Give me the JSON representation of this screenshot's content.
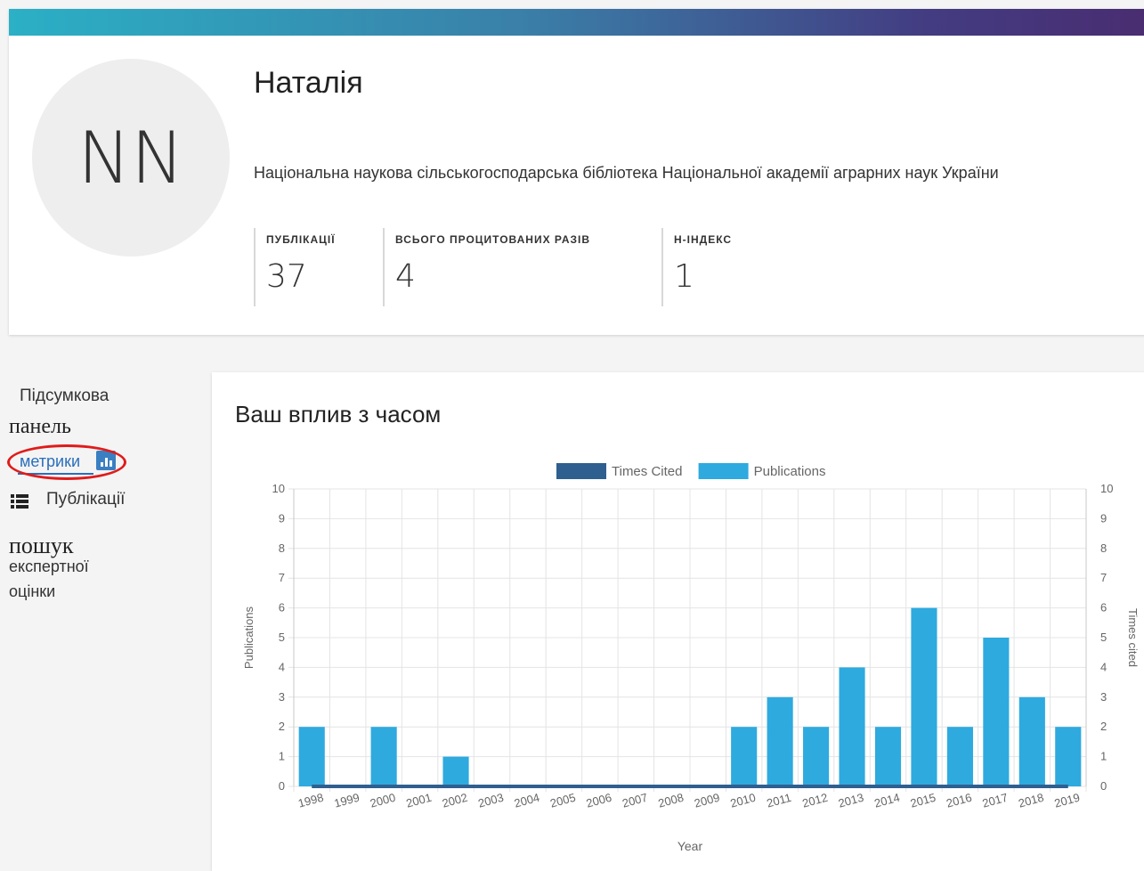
{
  "profile": {
    "initials": "NN",
    "name": "Наталія",
    "affiliation": "Національна наукова сільськогосподарська бібліотека Національної академії аграрних наук України",
    "metrics": [
      {
        "label": "ПУБЛІКАЦІЇ",
        "value": "37"
      },
      {
        "label": "ВСЬОГО ПРОЦИТОВАНИХ РАЗІВ",
        "value": "4"
      },
      {
        "label": "H-ІНДЕКС",
        "value": "1"
      }
    ]
  },
  "sidebar": {
    "summary_line1": "Підсумкова",
    "summary_line2": "панель",
    "metrics": "метрики",
    "publications": "Публікації",
    "search": "пошук",
    "peer_line1": "експертної",
    "peer_line2": "оцінки"
  },
  "chart_card": {
    "title": "Ваш вплив з часом"
  },
  "chart_data": {
    "type": "bar",
    "categories": [
      "1998",
      "1999",
      "2000",
      "2001",
      "2002",
      "2003",
      "2004",
      "2005",
      "2006",
      "2007",
      "2008",
      "2009",
      "2010",
      "2011",
      "2012",
      "2013",
      "2014",
      "2015",
      "2016",
      "2017",
      "2018",
      "2019"
    ],
    "series": [
      {
        "name": "Times Cited",
        "color": "#2f5f8f",
        "type": "line",
        "axis": "right",
        "values": [
          0,
          0,
          0,
          0,
          0,
          0,
          0,
          0,
          0,
          0,
          0,
          0,
          0,
          0,
          0,
          0,
          0,
          0,
          0,
          0,
          0,
          0
        ]
      },
      {
        "name": "Publications",
        "color": "#2eaadf",
        "type": "bar",
        "axis": "left",
        "values": [
          2,
          0,
          2,
          0,
          1,
          0,
          0,
          0,
          0,
          0,
          0,
          0,
          2,
          3,
          2,
          4,
          2,
          6,
          2,
          5,
          3,
          2
        ]
      }
    ],
    "xlabel": "Year",
    "ylabel": "Publications",
    "y2label": "Times cited",
    "ylim": [
      0,
      10
    ],
    "y2lim": [
      0,
      10
    ],
    "yticks": [
      "0",
      "1",
      "2",
      "3",
      "4",
      "5",
      "6",
      "7",
      "8",
      "9",
      "10"
    ],
    "legend_position": "top",
    "grid": true
  }
}
